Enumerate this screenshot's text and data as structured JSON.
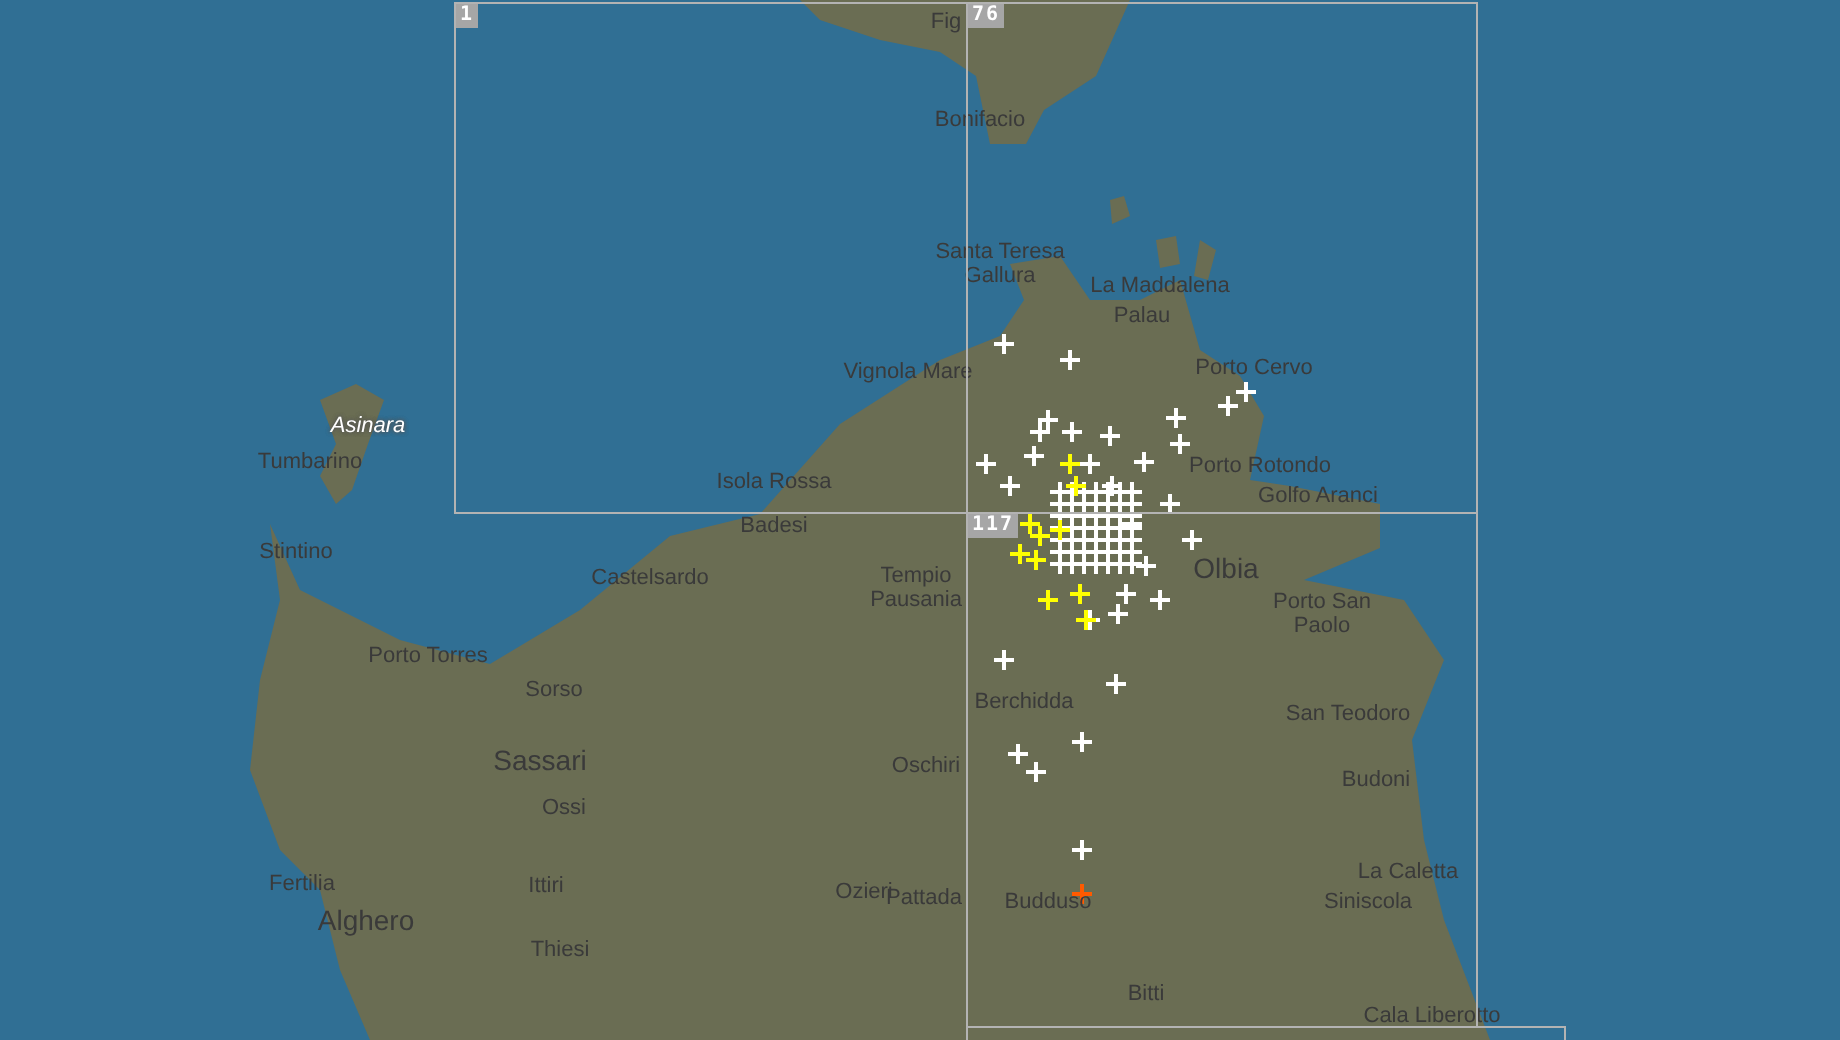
{
  "grid_cells": [
    {
      "count": "1"
    },
    {
      "count": "76"
    },
    {
      "count": "117"
    }
  ],
  "places": [
    {
      "name": "Fig",
      "kind": "town"
    },
    {
      "name": "Bonifacio",
      "kind": "town"
    },
    {
      "name": "Santa Teresa Gallura",
      "kind": "town"
    },
    {
      "name": "La Maddalena",
      "kind": "town"
    },
    {
      "name": "Palau",
      "kind": "town"
    },
    {
      "name": "Porto Cervo",
      "kind": "town"
    },
    {
      "name": "Vignola Mare",
      "kind": "town"
    },
    {
      "name": "Asinara",
      "kind": "island"
    },
    {
      "name": "Tumbarino",
      "kind": "town"
    },
    {
      "name": "Isola Rossa",
      "kind": "town"
    },
    {
      "name": "Porto Rotondo",
      "kind": "town"
    },
    {
      "name": "Golfo Aranci",
      "kind": "town"
    },
    {
      "name": "Stintino",
      "kind": "town"
    },
    {
      "name": "Badesi",
      "kind": "town"
    },
    {
      "name": "Castelsardo",
      "kind": "town"
    },
    {
      "name": "Tempio Pausania",
      "kind": "town"
    },
    {
      "name": "Olbia",
      "kind": "city"
    },
    {
      "name": "Porto San Paolo",
      "kind": "town"
    },
    {
      "name": "Porto Torres",
      "kind": "town"
    },
    {
      "name": "Sorso",
      "kind": "town"
    },
    {
      "name": "Berchidda",
      "kind": "town"
    },
    {
      "name": "San Teodoro",
      "kind": "town"
    },
    {
      "name": "Sassari",
      "kind": "city"
    },
    {
      "name": "Oschiri",
      "kind": "town"
    },
    {
      "name": "Budoni",
      "kind": "town"
    },
    {
      "name": "Ossi",
      "kind": "town"
    },
    {
      "name": "Fertilia",
      "kind": "town"
    },
    {
      "name": "Ittiri",
      "kind": "town"
    },
    {
      "name": "Ozieri",
      "kind": "town"
    },
    {
      "name": "La Caletta",
      "kind": "town"
    },
    {
      "name": "Pattada",
      "kind": "town"
    },
    {
      "name": "Budduso",
      "kind": "town"
    },
    {
      "name": "Siniscola",
      "kind": "town"
    },
    {
      "name": "Alghero",
      "kind": "city"
    },
    {
      "name": "Thiesi",
      "kind": "town"
    },
    {
      "name": "Bitti",
      "kind": "town"
    },
    {
      "name": "Cala Liberotto",
      "kind": "town"
    }
  ],
  "strikes": [
    {
      "color": "#ffffff"
    },
    {
      "color": "#ffff00"
    },
    {
      "color": "#ff5a00"
    }
  ]
}
